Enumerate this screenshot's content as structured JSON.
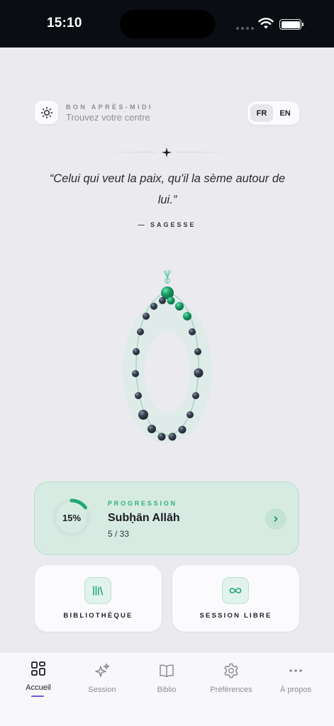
{
  "status_bar": {
    "time": "15:10"
  },
  "header": {
    "greeting_kicker": "BON APRÈS-MIDI",
    "greeting_subtitle": "Trouvez votre centre",
    "languages": [
      "FR",
      "EN"
    ],
    "selected_language": "FR"
  },
  "quote": {
    "text": "“Celui qui veut la paix, qu'il la sème autour de lui.”",
    "source": "— SAGESSE"
  },
  "progress": {
    "kicker": "PROGRESSION",
    "percent_label": "15%",
    "percent_value": 0.15,
    "dhikr_name": "Subḥān Allāh",
    "count_label": "5 / 33",
    "count_done": 5,
    "count_total": 33
  },
  "tiles": {
    "library_label": "BIBLIOTHÈQUE",
    "free_session_label": "SESSION LIBRE"
  },
  "tab_bar": {
    "active_tab": "Accueil",
    "tabs": [
      "Accueil",
      "Session",
      "Biblio",
      "Préférences",
      "À propos"
    ]
  },
  "colors": {
    "accent_green": "#2bb07f",
    "bead_dark": "#2f3848",
    "bead_green": "#16905f",
    "progress_card_bg": "#d7ebe3",
    "tab_indicator": "#6c5ce7",
    "background": "#ebebef"
  },
  "icons": {
    "sun": "sun-icon",
    "star": "sparkle-star-icon",
    "next": "chevron-right-icon",
    "library": "books-icon",
    "free_session": "infinity-icon",
    "tabs": [
      "grid-icon",
      "sparkles-icon",
      "book-open-icon",
      "gear-icon",
      "ellipsis-icon"
    ]
  }
}
